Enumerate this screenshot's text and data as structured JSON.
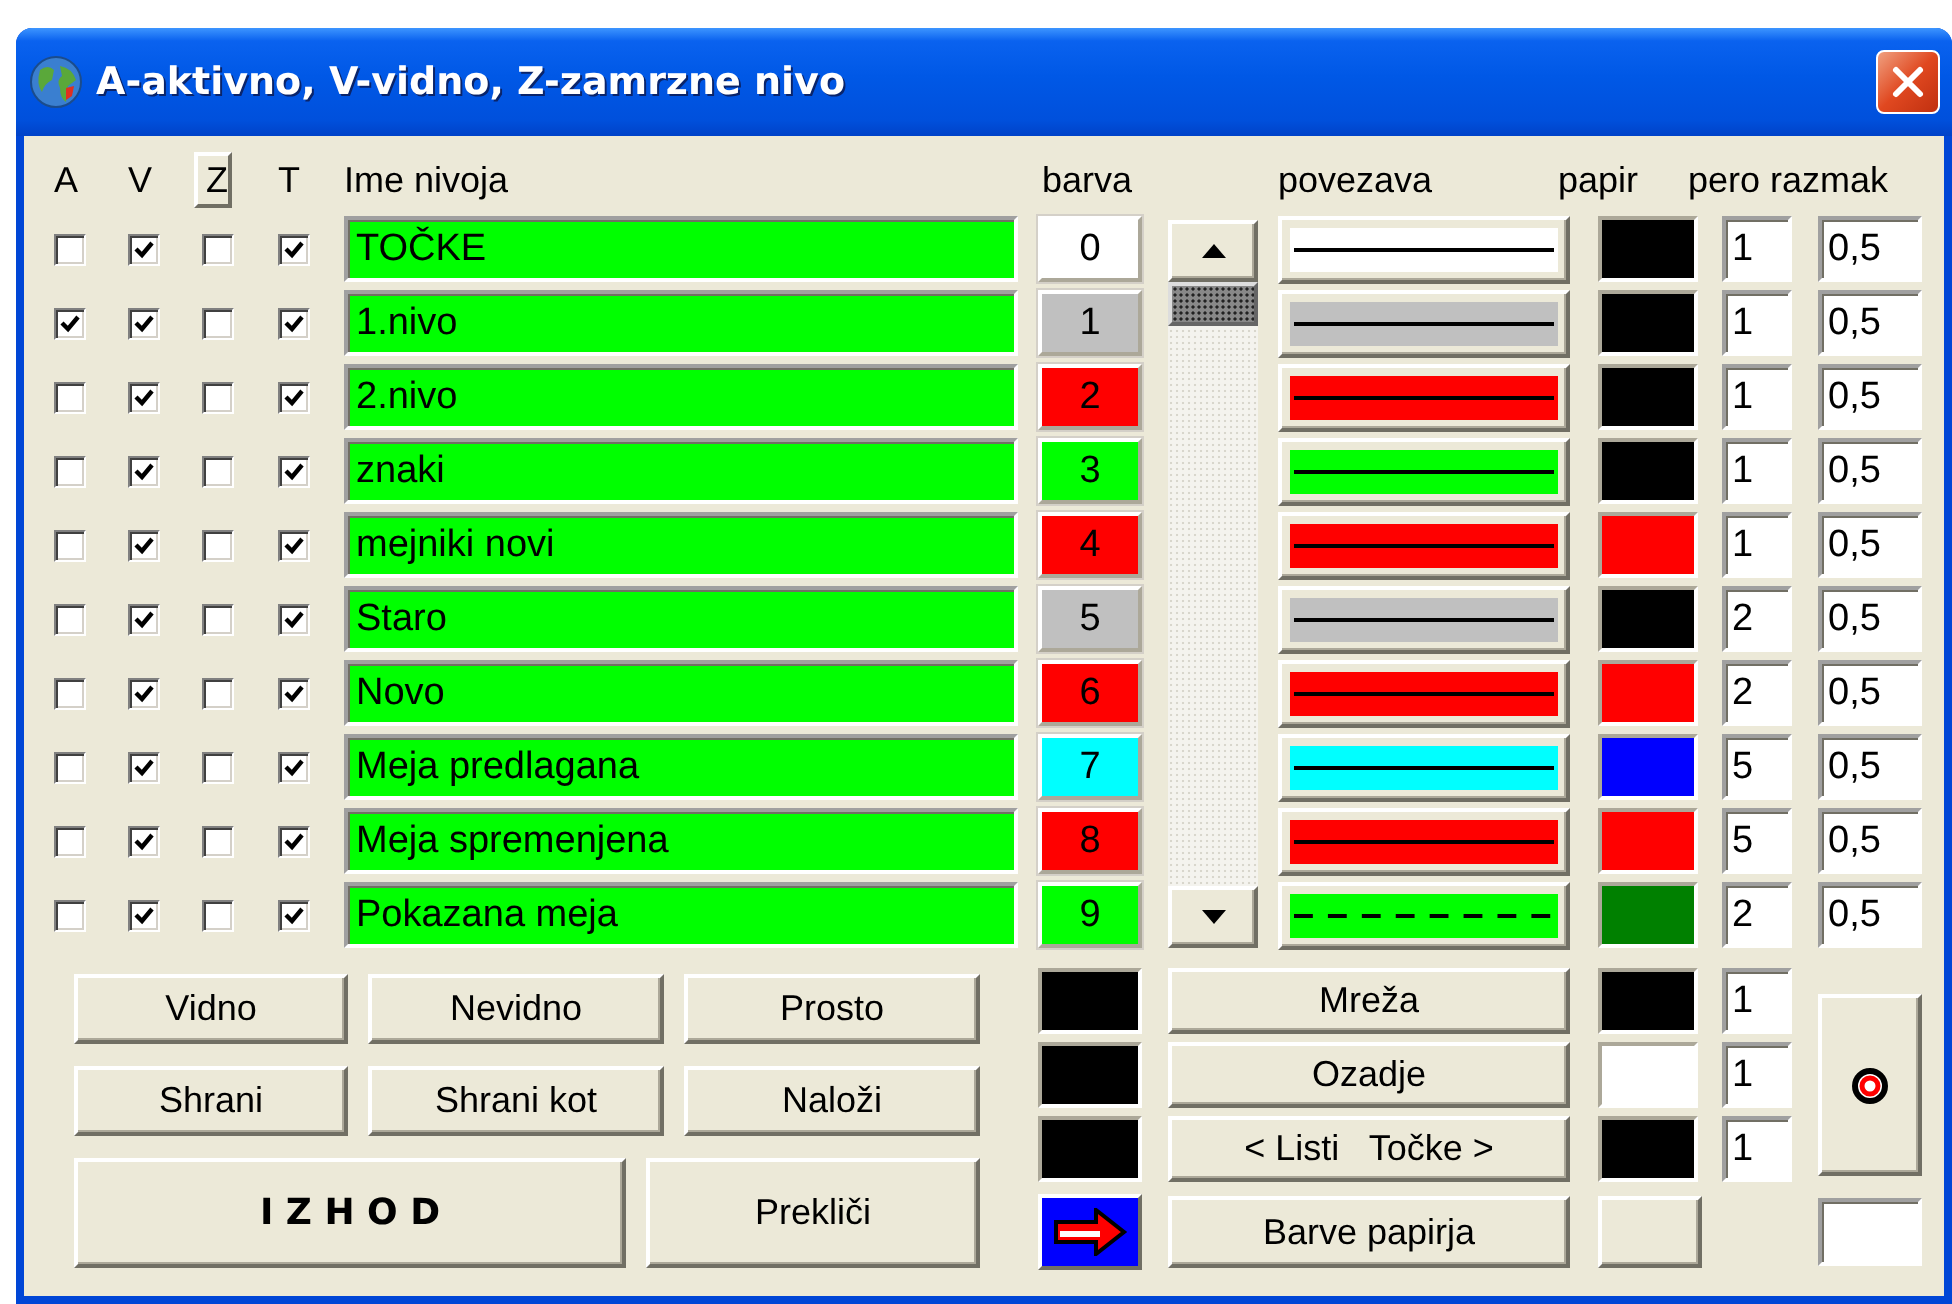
{
  "window": {
    "title": "A-aktivno, V-vidno, Z-zamrzne nivo"
  },
  "columns": [
    {
      "label": "A",
      "kind": "label"
    },
    {
      "label": "V",
      "kind": "label"
    },
    {
      "label": "Z",
      "kind": "toggle"
    },
    {
      "label": "T",
      "kind": "label"
    },
    {
      "label": "Ime nivoja",
      "kind": "label"
    },
    {
      "label": "barva",
      "kind": "label"
    },
    {
      "label": "povezava",
      "kind": "label"
    },
    {
      "label": "papir",
      "kind": "label"
    },
    {
      "label": "pero razmak",
      "kind": "label"
    }
  ],
  "rows": [
    {
      "active": false,
      "visible": true,
      "frozen": false,
      "t": true,
      "name": "TOČKE",
      "index": "0",
      "color": "#ffffff",
      "line": {
        "kind": "solid",
        "color": "#ffffff"
      },
      "paper": {
        "color": "#000000"
      },
      "pen": "1",
      "spacing": "0,5"
    },
    {
      "active": true,
      "visible": true,
      "frozen": false,
      "t": true,
      "name": "1.nivo",
      "index": "1",
      "color": "#c0c0c0",
      "line": {
        "kind": "solid",
        "color": "#c0c0c0"
      },
      "paper": {
        "color": "#000000"
      },
      "pen": "1",
      "spacing": "0,5"
    },
    {
      "active": false,
      "visible": true,
      "frozen": false,
      "t": true,
      "name": "2.nivo",
      "index": "2",
      "color": "#ff0000",
      "line": {
        "kind": "solid",
        "color": "#ff0000"
      },
      "paper": {
        "color": "#000000"
      },
      "pen": "1",
      "spacing": "0,5"
    },
    {
      "active": false,
      "visible": true,
      "frozen": false,
      "t": true,
      "name": "znaki",
      "index": "3",
      "color": "#00ff00",
      "line": {
        "kind": "solid",
        "color": "#00ff00"
      },
      "paper": {
        "color": "#000000"
      },
      "pen": "1",
      "spacing": "0,5"
    },
    {
      "active": false,
      "visible": true,
      "frozen": false,
      "t": true,
      "name": "mejniki novi",
      "index": "4",
      "color": "#ff0000",
      "line": {
        "kind": "solid",
        "color": "#ff0000"
      },
      "paper": {
        "color": "#ff0000"
      },
      "pen": "1",
      "spacing": "0,5"
    },
    {
      "active": false,
      "visible": true,
      "frozen": false,
      "t": true,
      "name": "Staro",
      "index": "5",
      "color": "#c0c0c0",
      "line": {
        "kind": "solid",
        "color": "#c0c0c0"
      },
      "paper": {
        "color": "#000000"
      },
      "pen": "2",
      "spacing": "0,5"
    },
    {
      "active": false,
      "visible": true,
      "frozen": false,
      "t": true,
      "name": "Novo",
      "index": "6",
      "color": "#ff0000",
      "line": {
        "kind": "solid",
        "color": "#ff0000"
      },
      "paper": {
        "color": "#ff0000"
      },
      "pen": "2",
      "spacing": "0,5"
    },
    {
      "active": false,
      "visible": true,
      "frozen": false,
      "t": true,
      "name": "Meja predlagana",
      "index": "7",
      "color": "#00ffff",
      "line": {
        "kind": "solid",
        "color": "#00ffff"
      },
      "paper": {
        "color": "#0000ff"
      },
      "pen": "5",
      "spacing": "0,5"
    },
    {
      "active": false,
      "visible": true,
      "frozen": false,
      "t": true,
      "name": "Meja spremenjena",
      "index": "8",
      "color": "#ff0000",
      "line": {
        "kind": "solid",
        "color": "#ff0000"
      },
      "paper": {
        "color": "#ff0000"
      },
      "pen": "5",
      "spacing": "0,5"
    },
    {
      "active": false,
      "visible": true,
      "frozen": false,
      "t": true,
      "name": "Pokazana meja",
      "index": "9",
      "color": "#00ff00",
      "line": {
        "kind": "dashed",
        "color": "#00ff00"
      },
      "paper": {
        "color": "#008000"
      },
      "pen": "2",
      "spacing": "0,5"
    }
  ],
  "button_rows": [
    {
      "buttons": [
        {
          "label": "Vidno"
        },
        {
          "label": "Nevidno"
        },
        {
          "label": "Prosto"
        }
      ]
    },
    {
      "buttons": [
        {
          "label": "Shrani"
        },
        {
          "label": "Shrani kot"
        },
        {
          "label": "Naloži"
        }
      ]
    },
    {
      "buttons": [
        {
          "label": "I Z H O D",
          "kind": "primary"
        },
        {
          "label": "Prekliči",
          "kind": "normal"
        }
      ]
    }
  ],
  "extras": [
    {
      "swatch": {
        "color": "#000000"
      },
      "button": "Mreža",
      "paper": {
        "color": "#000000"
      },
      "pen": "1"
    },
    {
      "swatch": {
        "color": "#000000"
      },
      "button": "Ozadje",
      "paper": {
        "color": "#ffffff"
      },
      "pen": "1"
    },
    {
      "swatch": {
        "color": "#000000"
      },
      "button": "< Listi   Točke >",
      "paper": {
        "color": "#000000"
      },
      "pen": "1"
    }
  ],
  "paper_colors_button": {
    "label": "Barve papirja"
  }
}
